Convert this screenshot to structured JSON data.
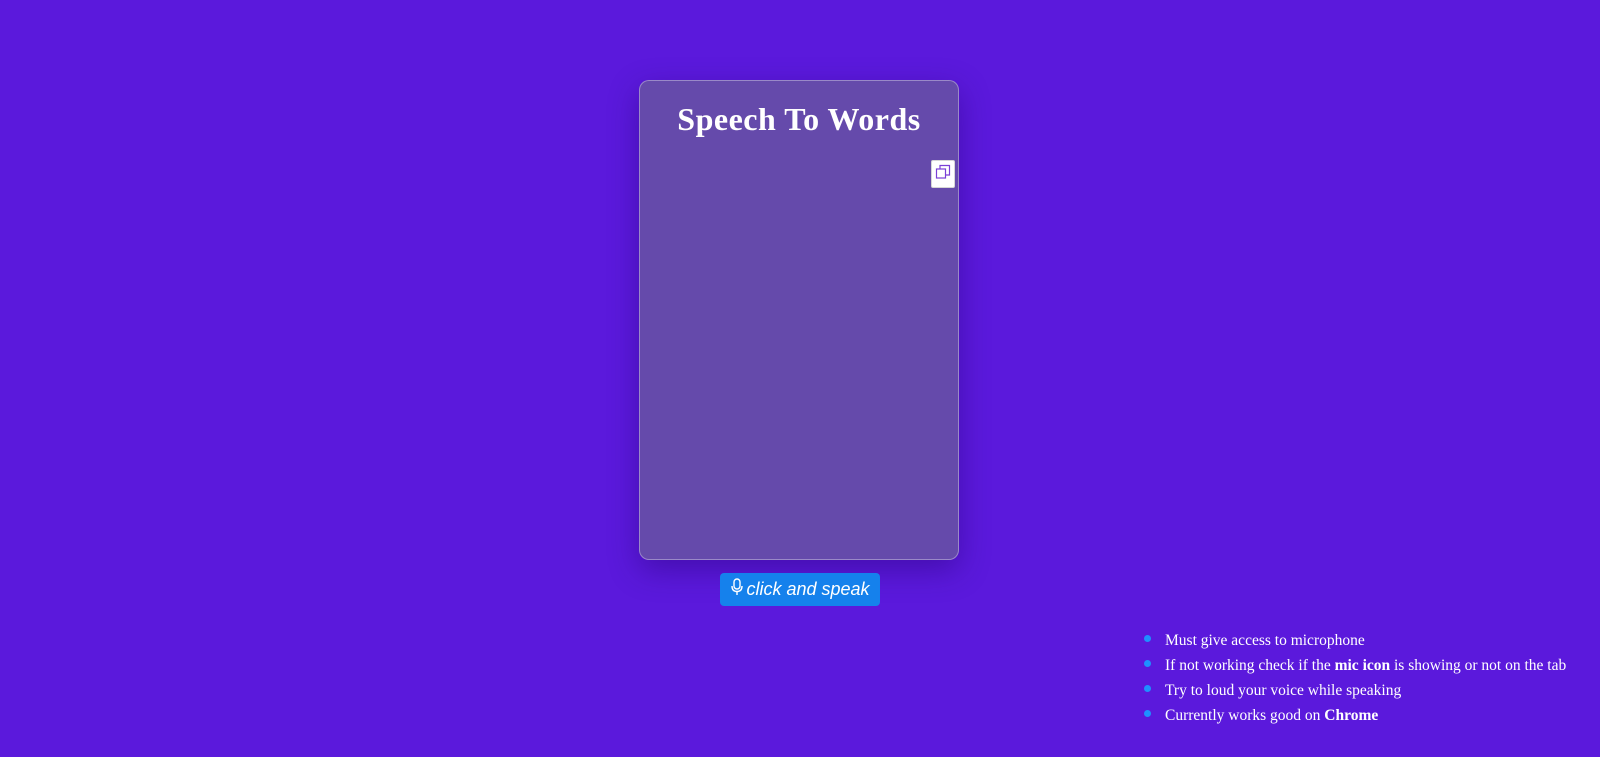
{
  "card": {
    "title": "Speech To Words",
    "transcript": "",
    "copy_icon": "copy-icon"
  },
  "speak_button": {
    "label": "click and speak",
    "icon": "microphone-icon"
  },
  "notes": [
    {
      "before": "Must give access to microphone",
      "bold": "",
      "after": ""
    },
    {
      "before": "If not working check if the ",
      "bold": "mic icon",
      "after": " is showing or not on the tab"
    },
    {
      "before": "Try to loud your voice while speaking",
      "bold": "",
      "after": ""
    },
    {
      "before": "Currently works good on ",
      "bold": "Chrome",
      "after": ""
    }
  ],
  "colors": {
    "background": "#5b19dc",
    "card": "#654aab",
    "button": "#1581ec",
    "bullet": "#1e90ff"
  }
}
